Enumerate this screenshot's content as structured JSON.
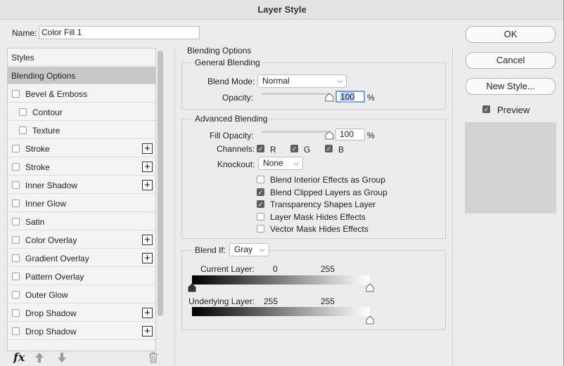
{
  "window": {
    "title": "Layer Style"
  },
  "name": {
    "label": "Name:",
    "value": "Color Fill 1"
  },
  "styles_list": {
    "header": "Styles",
    "items": [
      {
        "label": "Blending Options",
        "checkbox": false,
        "checked": false,
        "plus": false,
        "selected": true,
        "indent": false
      },
      {
        "label": "Bevel & Emboss",
        "checkbox": true,
        "checked": false,
        "plus": false,
        "selected": false,
        "indent": false
      },
      {
        "label": "Contour",
        "checkbox": true,
        "checked": false,
        "plus": false,
        "selected": false,
        "indent": true
      },
      {
        "label": "Texture",
        "checkbox": true,
        "checked": false,
        "plus": false,
        "selected": false,
        "indent": true
      },
      {
        "label": "Stroke",
        "checkbox": true,
        "checked": false,
        "plus": true,
        "selected": false,
        "indent": false
      },
      {
        "label": "Stroke",
        "checkbox": true,
        "checked": false,
        "plus": true,
        "selected": false,
        "indent": false
      },
      {
        "label": "Inner Shadow",
        "checkbox": true,
        "checked": false,
        "plus": true,
        "selected": false,
        "indent": false
      },
      {
        "label": "Inner Glow",
        "checkbox": true,
        "checked": false,
        "plus": false,
        "selected": false,
        "indent": false
      },
      {
        "label": "Satin",
        "checkbox": true,
        "checked": false,
        "plus": false,
        "selected": false,
        "indent": false
      },
      {
        "label": "Color Overlay",
        "checkbox": true,
        "checked": false,
        "plus": true,
        "selected": false,
        "indent": false
      },
      {
        "label": "Gradient Overlay",
        "checkbox": true,
        "checked": false,
        "plus": true,
        "selected": false,
        "indent": false
      },
      {
        "label": "Pattern Overlay",
        "checkbox": true,
        "checked": false,
        "plus": false,
        "selected": false,
        "indent": false
      },
      {
        "label": "Outer Glow",
        "checkbox": true,
        "checked": false,
        "plus": false,
        "selected": false,
        "indent": false
      },
      {
        "label": "Drop Shadow",
        "checkbox": true,
        "checked": false,
        "plus": true,
        "selected": false,
        "indent": false
      },
      {
        "label": "Drop Shadow",
        "checkbox": true,
        "checked": false,
        "plus": true,
        "selected": false,
        "indent": false
      }
    ]
  },
  "blending_options": {
    "title": "Blending Options",
    "general": {
      "title": "General Blending",
      "blend_mode_label": "Blend Mode:",
      "blend_mode_value": "Normal",
      "opacity_label": "Opacity:",
      "opacity_value": "100",
      "opacity_unit": "%",
      "opacity_fraction": 1.0
    },
    "advanced": {
      "title": "Advanced Blending",
      "fill_opacity_label": "Fill Opacity:",
      "fill_opacity_value": "100",
      "fill_opacity_unit": "%",
      "fill_opacity_fraction": 1.0,
      "channels_label": "Channels:",
      "channel_r": "R",
      "channel_g": "G",
      "channel_b": "B",
      "knockout_label": "Knockout:",
      "knockout_value": "None",
      "options": [
        {
          "label": "Blend Interior Effects as Group",
          "checked": false
        },
        {
          "label": "Blend Clipped Layers as Group",
          "checked": true
        },
        {
          "label": "Transparency Shapes Layer",
          "checked": true
        },
        {
          "label": "Layer Mask Hides Effects",
          "checked": false
        },
        {
          "label": "Vector Mask Hides Effects",
          "checked": false
        }
      ]
    },
    "blend_if": {
      "label": "Blend If:",
      "value": "Gray",
      "current_layer_label": "Current Layer:",
      "current_low": "0",
      "current_high": "255",
      "underlying_layer_label": "Underlying Layer:",
      "underlying_low": "255",
      "underlying_high": "255"
    }
  },
  "buttons": {
    "ok": "OK",
    "cancel": "Cancel",
    "new_style": "New Style..."
  },
  "preview": {
    "label": "Preview",
    "checked": true
  },
  "icons": {
    "fx": "fx",
    "up": "arrow-up-icon",
    "down": "arrow-down-icon",
    "trash": "trash-icon"
  }
}
